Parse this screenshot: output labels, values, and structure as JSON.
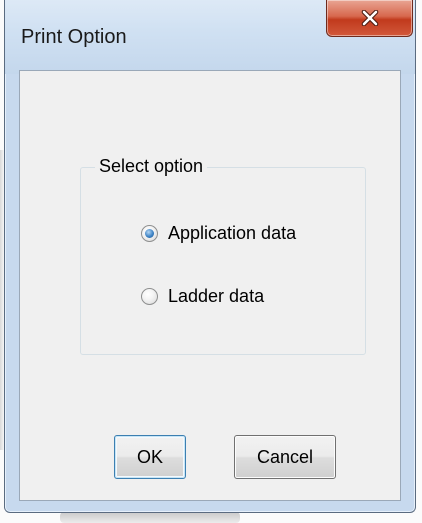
{
  "window": {
    "title": "Print Option"
  },
  "close_button": {
    "icon": "close-icon",
    "color": "#c7452a"
  },
  "group": {
    "legend": "Select option",
    "options": [
      {
        "label": "Application data",
        "selected": true
      },
      {
        "label": "Ladder data",
        "selected": false
      }
    ]
  },
  "buttons": {
    "ok_label": "OK",
    "cancel_label": "Cancel"
  },
  "colors": {
    "titlebar": "#cfe0f2",
    "client": "#f0f0f0",
    "radio_selected": "#3f84c6"
  }
}
